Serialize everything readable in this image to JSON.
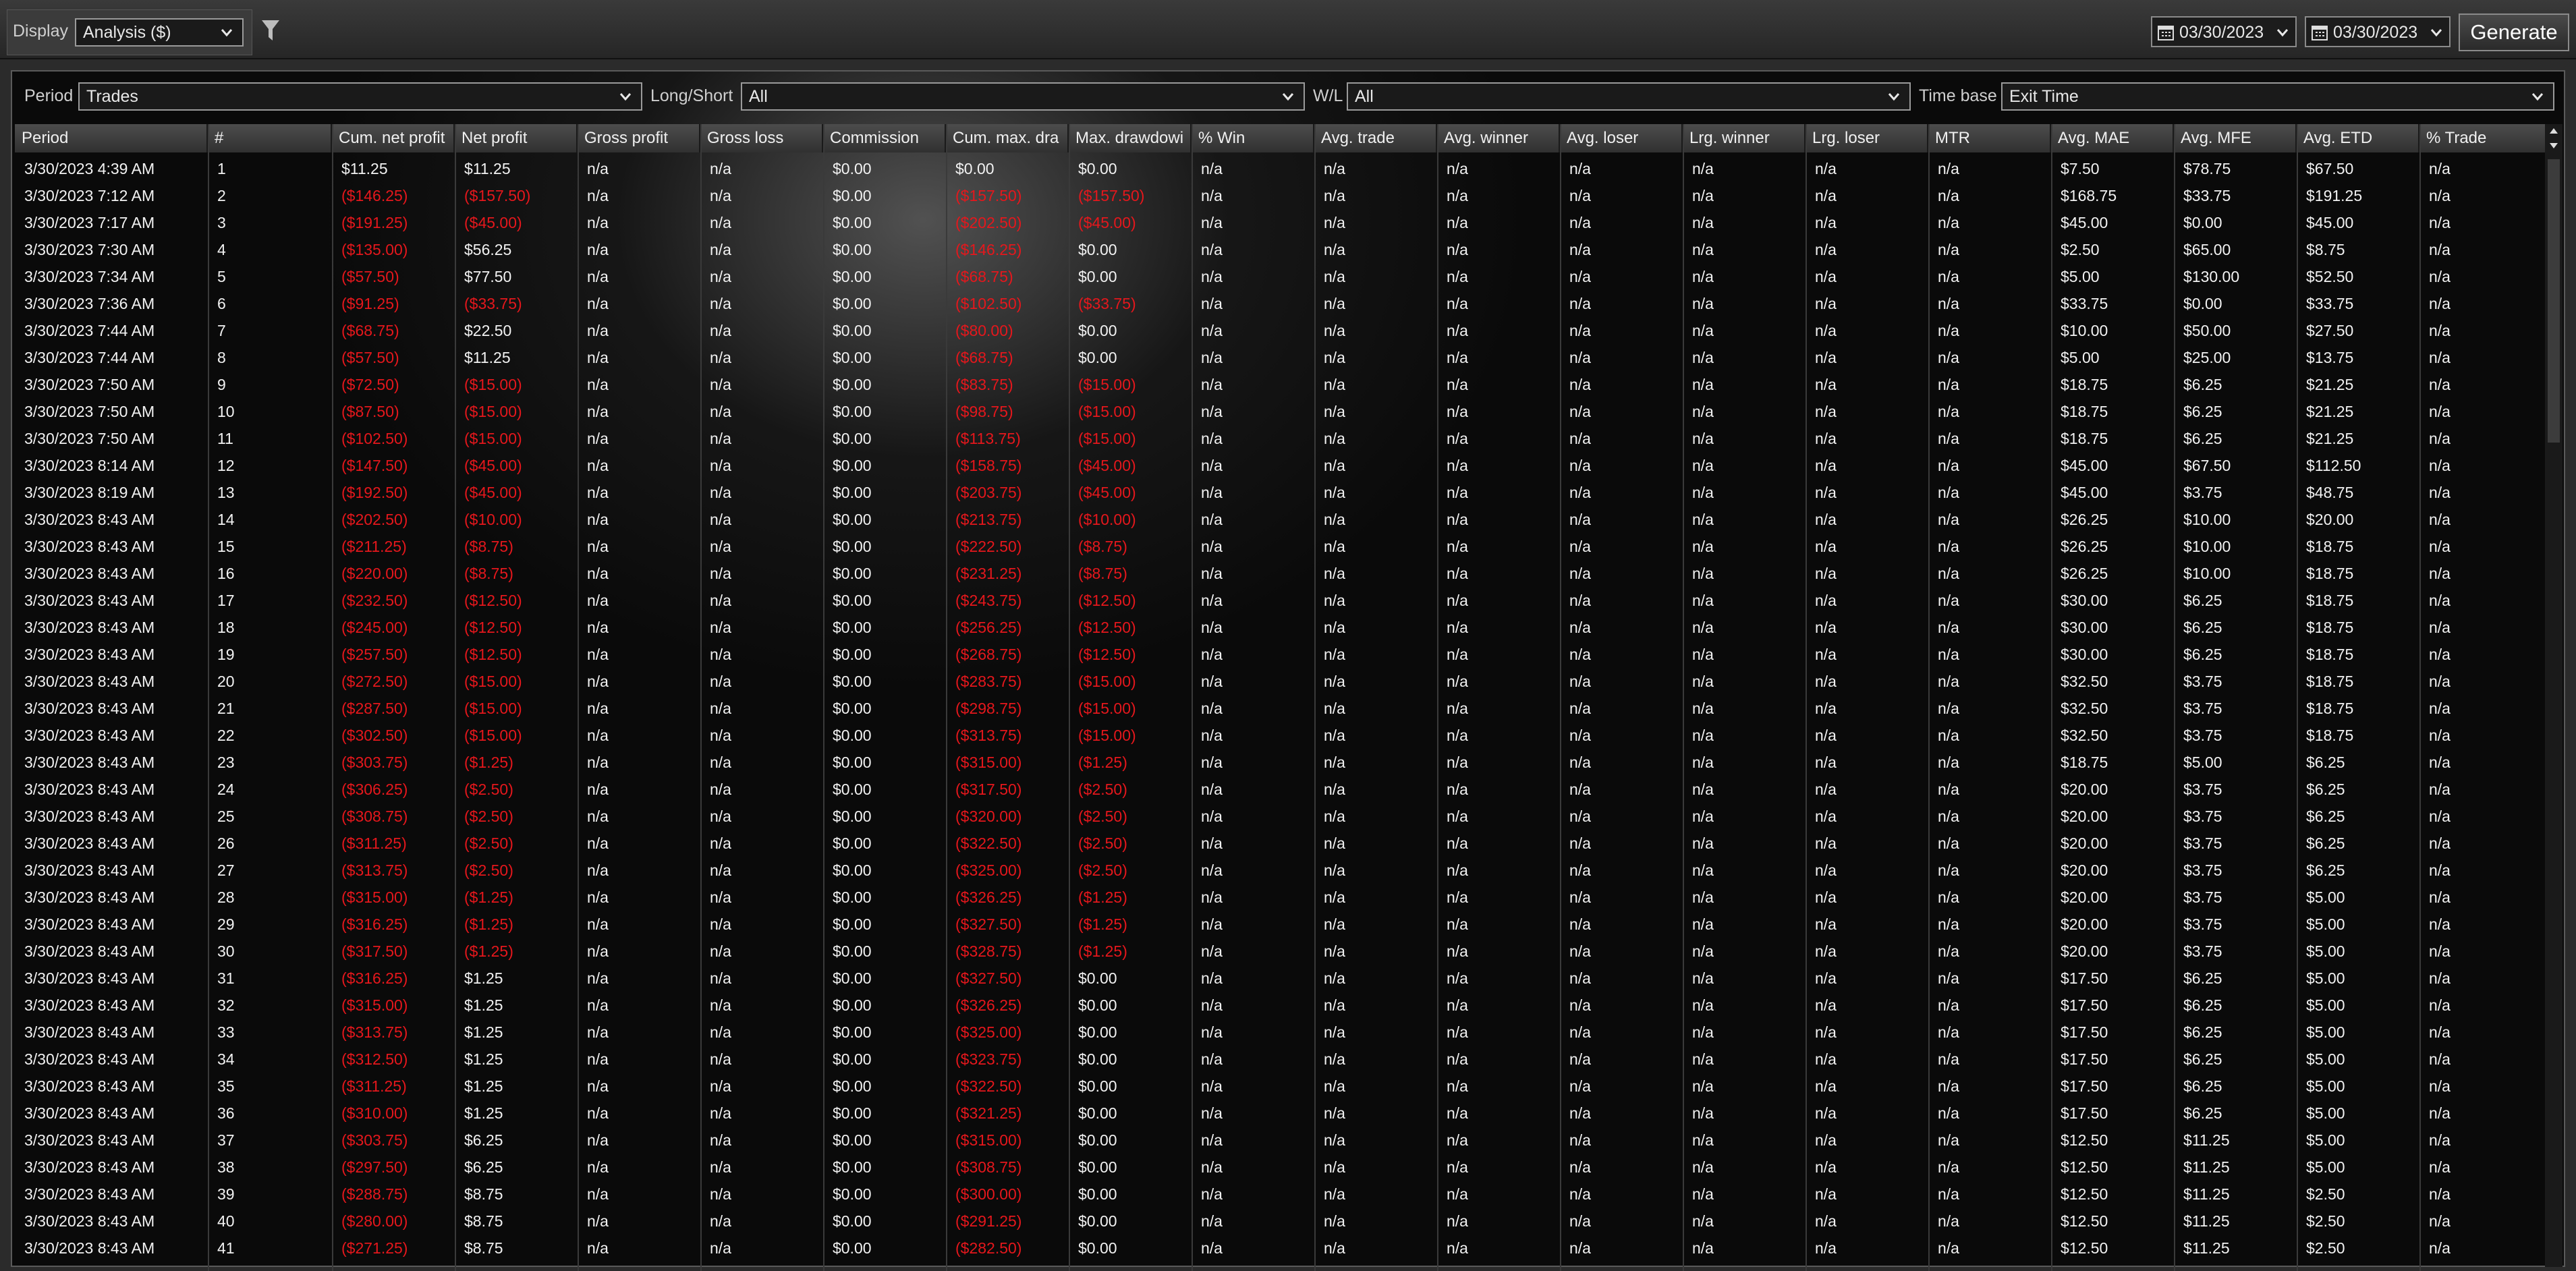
{
  "toolbar": {
    "display_label": "Display",
    "display_value": "Analysis ($)",
    "date_from": "03/30/2023",
    "date_to": "03/30/2023",
    "generate_label": "Generate"
  },
  "filters": {
    "period_label": "Period",
    "period_value": "Trades",
    "longshort_label": "Long/Short",
    "longshort_value": "All",
    "wl_label": "W/L",
    "wl_value": "All",
    "timebase_label": "Time base",
    "timebase_value": "Exit Time"
  },
  "columns": [
    "Period",
    "#",
    "Cum. net profit",
    "Net profit",
    "Gross profit",
    "Gross loss",
    "Commission",
    "Cum. max. dra",
    "Max. drawdowi",
    "% Win",
    "Avg. trade",
    "Avg. winner",
    "Avg. loser",
    "Lrg. winner",
    "Lrg. loser",
    "MTR",
    "Avg. MAE",
    "Avg. MFE",
    "Avg. ETD",
    "% Trade"
  ],
  "rows": [
    [
      "3/30/2023 4:39 AM",
      "1",
      "$11.25",
      "$11.25",
      "n/a",
      "n/a",
      "$0.00",
      "$0.00",
      "$0.00",
      "n/a",
      "n/a",
      "n/a",
      "n/a",
      "n/a",
      "n/a",
      "n/a",
      "$7.50",
      "$78.75",
      "$67.50",
      "n/a"
    ],
    [
      "3/30/2023 7:12 AM",
      "2",
      "($146.25)",
      "($157.50)",
      "n/a",
      "n/a",
      "$0.00",
      "($157.50)",
      "($157.50)",
      "n/a",
      "n/a",
      "n/a",
      "n/a",
      "n/a",
      "n/a",
      "n/a",
      "$168.75",
      "$33.75",
      "$191.25",
      "n/a"
    ],
    [
      "3/30/2023 7:17 AM",
      "3",
      "($191.25)",
      "($45.00)",
      "n/a",
      "n/a",
      "$0.00",
      "($202.50)",
      "($45.00)",
      "n/a",
      "n/a",
      "n/a",
      "n/a",
      "n/a",
      "n/a",
      "n/a",
      "$45.00",
      "$0.00",
      "$45.00",
      "n/a"
    ],
    [
      "3/30/2023 7:30 AM",
      "4",
      "($135.00)",
      "$56.25",
      "n/a",
      "n/a",
      "$0.00",
      "($146.25)",
      "$0.00",
      "n/a",
      "n/a",
      "n/a",
      "n/a",
      "n/a",
      "n/a",
      "n/a",
      "$2.50",
      "$65.00",
      "$8.75",
      "n/a"
    ],
    [
      "3/30/2023 7:34 AM",
      "5",
      "($57.50)",
      "$77.50",
      "n/a",
      "n/a",
      "$0.00",
      "($68.75)",
      "$0.00",
      "n/a",
      "n/a",
      "n/a",
      "n/a",
      "n/a",
      "n/a",
      "n/a",
      "$5.00",
      "$130.00",
      "$52.50",
      "n/a"
    ],
    [
      "3/30/2023 7:36 AM",
      "6",
      "($91.25)",
      "($33.75)",
      "n/a",
      "n/a",
      "$0.00",
      "($102.50)",
      "($33.75)",
      "n/a",
      "n/a",
      "n/a",
      "n/a",
      "n/a",
      "n/a",
      "n/a",
      "$33.75",
      "$0.00",
      "$33.75",
      "n/a"
    ],
    [
      "3/30/2023 7:44 AM",
      "7",
      "($68.75)",
      "$22.50",
      "n/a",
      "n/a",
      "$0.00",
      "($80.00)",
      "$0.00",
      "n/a",
      "n/a",
      "n/a",
      "n/a",
      "n/a",
      "n/a",
      "n/a",
      "$10.00",
      "$50.00",
      "$27.50",
      "n/a"
    ],
    [
      "3/30/2023 7:44 AM",
      "8",
      "($57.50)",
      "$11.25",
      "n/a",
      "n/a",
      "$0.00",
      "($68.75)",
      "$0.00",
      "n/a",
      "n/a",
      "n/a",
      "n/a",
      "n/a",
      "n/a",
      "n/a",
      "$5.00",
      "$25.00",
      "$13.75",
      "n/a"
    ],
    [
      "3/30/2023 7:50 AM",
      "9",
      "($72.50)",
      "($15.00)",
      "n/a",
      "n/a",
      "$0.00",
      "($83.75)",
      "($15.00)",
      "n/a",
      "n/a",
      "n/a",
      "n/a",
      "n/a",
      "n/a",
      "n/a",
      "$18.75",
      "$6.25",
      "$21.25",
      "n/a"
    ],
    [
      "3/30/2023 7:50 AM",
      "10",
      "($87.50)",
      "($15.00)",
      "n/a",
      "n/a",
      "$0.00",
      "($98.75)",
      "($15.00)",
      "n/a",
      "n/a",
      "n/a",
      "n/a",
      "n/a",
      "n/a",
      "n/a",
      "$18.75",
      "$6.25",
      "$21.25",
      "n/a"
    ],
    [
      "3/30/2023 7:50 AM",
      "11",
      "($102.50)",
      "($15.00)",
      "n/a",
      "n/a",
      "$0.00",
      "($113.75)",
      "($15.00)",
      "n/a",
      "n/a",
      "n/a",
      "n/a",
      "n/a",
      "n/a",
      "n/a",
      "$18.75",
      "$6.25",
      "$21.25",
      "n/a"
    ],
    [
      "3/30/2023 8:14 AM",
      "12",
      "($147.50)",
      "($45.00)",
      "n/a",
      "n/a",
      "$0.00",
      "($158.75)",
      "($45.00)",
      "n/a",
      "n/a",
      "n/a",
      "n/a",
      "n/a",
      "n/a",
      "n/a",
      "$45.00",
      "$67.50",
      "$112.50",
      "n/a"
    ],
    [
      "3/30/2023 8:19 AM",
      "13",
      "($192.50)",
      "($45.00)",
      "n/a",
      "n/a",
      "$0.00",
      "($203.75)",
      "($45.00)",
      "n/a",
      "n/a",
      "n/a",
      "n/a",
      "n/a",
      "n/a",
      "n/a",
      "$45.00",
      "$3.75",
      "$48.75",
      "n/a"
    ],
    [
      "3/30/2023 8:43 AM",
      "14",
      "($202.50)",
      "($10.00)",
      "n/a",
      "n/a",
      "$0.00",
      "($213.75)",
      "($10.00)",
      "n/a",
      "n/a",
      "n/a",
      "n/a",
      "n/a",
      "n/a",
      "n/a",
      "$26.25",
      "$10.00",
      "$20.00",
      "n/a"
    ],
    [
      "3/30/2023 8:43 AM",
      "15",
      "($211.25)",
      "($8.75)",
      "n/a",
      "n/a",
      "$0.00",
      "($222.50)",
      "($8.75)",
      "n/a",
      "n/a",
      "n/a",
      "n/a",
      "n/a",
      "n/a",
      "n/a",
      "$26.25",
      "$10.00",
      "$18.75",
      "n/a"
    ],
    [
      "3/30/2023 8:43 AM",
      "16",
      "($220.00)",
      "($8.75)",
      "n/a",
      "n/a",
      "$0.00",
      "($231.25)",
      "($8.75)",
      "n/a",
      "n/a",
      "n/a",
      "n/a",
      "n/a",
      "n/a",
      "n/a",
      "$26.25",
      "$10.00",
      "$18.75",
      "n/a"
    ],
    [
      "3/30/2023 8:43 AM",
      "17",
      "($232.50)",
      "($12.50)",
      "n/a",
      "n/a",
      "$0.00",
      "($243.75)",
      "($12.50)",
      "n/a",
      "n/a",
      "n/a",
      "n/a",
      "n/a",
      "n/a",
      "n/a",
      "$30.00",
      "$6.25",
      "$18.75",
      "n/a"
    ],
    [
      "3/30/2023 8:43 AM",
      "18",
      "($245.00)",
      "($12.50)",
      "n/a",
      "n/a",
      "$0.00",
      "($256.25)",
      "($12.50)",
      "n/a",
      "n/a",
      "n/a",
      "n/a",
      "n/a",
      "n/a",
      "n/a",
      "$30.00",
      "$6.25",
      "$18.75",
      "n/a"
    ],
    [
      "3/30/2023 8:43 AM",
      "19",
      "($257.50)",
      "($12.50)",
      "n/a",
      "n/a",
      "$0.00",
      "($268.75)",
      "($12.50)",
      "n/a",
      "n/a",
      "n/a",
      "n/a",
      "n/a",
      "n/a",
      "n/a",
      "$30.00",
      "$6.25",
      "$18.75",
      "n/a"
    ],
    [
      "3/30/2023 8:43 AM",
      "20",
      "($272.50)",
      "($15.00)",
      "n/a",
      "n/a",
      "$0.00",
      "($283.75)",
      "($15.00)",
      "n/a",
      "n/a",
      "n/a",
      "n/a",
      "n/a",
      "n/a",
      "n/a",
      "$32.50",
      "$3.75",
      "$18.75",
      "n/a"
    ],
    [
      "3/30/2023 8:43 AM",
      "21",
      "($287.50)",
      "($15.00)",
      "n/a",
      "n/a",
      "$0.00",
      "($298.75)",
      "($15.00)",
      "n/a",
      "n/a",
      "n/a",
      "n/a",
      "n/a",
      "n/a",
      "n/a",
      "$32.50",
      "$3.75",
      "$18.75",
      "n/a"
    ],
    [
      "3/30/2023 8:43 AM",
      "22",
      "($302.50)",
      "($15.00)",
      "n/a",
      "n/a",
      "$0.00",
      "($313.75)",
      "($15.00)",
      "n/a",
      "n/a",
      "n/a",
      "n/a",
      "n/a",
      "n/a",
      "n/a",
      "$32.50",
      "$3.75",
      "$18.75",
      "n/a"
    ],
    [
      "3/30/2023 8:43 AM",
      "23",
      "($303.75)",
      "($1.25)",
      "n/a",
      "n/a",
      "$0.00",
      "($315.00)",
      "($1.25)",
      "n/a",
      "n/a",
      "n/a",
      "n/a",
      "n/a",
      "n/a",
      "n/a",
      "$18.75",
      "$5.00",
      "$6.25",
      "n/a"
    ],
    [
      "3/30/2023 8:43 AM",
      "24",
      "($306.25)",
      "($2.50)",
      "n/a",
      "n/a",
      "$0.00",
      "($317.50)",
      "($2.50)",
      "n/a",
      "n/a",
      "n/a",
      "n/a",
      "n/a",
      "n/a",
      "n/a",
      "$20.00",
      "$3.75",
      "$6.25",
      "n/a"
    ],
    [
      "3/30/2023 8:43 AM",
      "25",
      "($308.75)",
      "($2.50)",
      "n/a",
      "n/a",
      "$0.00",
      "($320.00)",
      "($2.50)",
      "n/a",
      "n/a",
      "n/a",
      "n/a",
      "n/a",
      "n/a",
      "n/a",
      "$20.00",
      "$3.75",
      "$6.25",
      "n/a"
    ],
    [
      "3/30/2023 8:43 AM",
      "26",
      "($311.25)",
      "($2.50)",
      "n/a",
      "n/a",
      "$0.00",
      "($322.50)",
      "($2.50)",
      "n/a",
      "n/a",
      "n/a",
      "n/a",
      "n/a",
      "n/a",
      "n/a",
      "$20.00",
      "$3.75",
      "$6.25",
      "n/a"
    ],
    [
      "3/30/2023 8:43 AM",
      "27",
      "($313.75)",
      "($2.50)",
      "n/a",
      "n/a",
      "$0.00",
      "($325.00)",
      "($2.50)",
      "n/a",
      "n/a",
      "n/a",
      "n/a",
      "n/a",
      "n/a",
      "n/a",
      "$20.00",
      "$3.75",
      "$6.25",
      "n/a"
    ],
    [
      "3/30/2023 8:43 AM",
      "28",
      "($315.00)",
      "($1.25)",
      "n/a",
      "n/a",
      "$0.00",
      "($326.25)",
      "($1.25)",
      "n/a",
      "n/a",
      "n/a",
      "n/a",
      "n/a",
      "n/a",
      "n/a",
      "$20.00",
      "$3.75",
      "$5.00",
      "n/a"
    ],
    [
      "3/30/2023 8:43 AM",
      "29",
      "($316.25)",
      "($1.25)",
      "n/a",
      "n/a",
      "$0.00",
      "($327.50)",
      "($1.25)",
      "n/a",
      "n/a",
      "n/a",
      "n/a",
      "n/a",
      "n/a",
      "n/a",
      "$20.00",
      "$3.75",
      "$5.00",
      "n/a"
    ],
    [
      "3/30/2023 8:43 AM",
      "30",
      "($317.50)",
      "($1.25)",
      "n/a",
      "n/a",
      "$0.00",
      "($328.75)",
      "($1.25)",
      "n/a",
      "n/a",
      "n/a",
      "n/a",
      "n/a",
      "n/a",
      "n/a",
      "$20.00",
      "$3.75",
      "$5.00",
      "n/a"
    ],
    [
      "3/30/2023 8:43 AM",
      "31",
      "($316.25)",
      "$1.25",
      "n/a",
      "n/a",
      "$0.00",
      "($327.50)",
      "$0.00",
      "n/a",
      "n/a",
      "n/a",
      "n/a",
      "n/a",
      "n/a",
      "n/a",
      "$17.50",
      "$6.25",
      "$5.00",
      "n/a"
    ],
    [
      "3/30/2023 8:43 AM",
      "32",
      "($315.00)",
      "$1.25",
      "n/a",
      "n/a",
      "$0.00",
      "($326.25)",
      "$0.00",
      "n/a",
      "n/a",
      "n/a",
      "n/a",
      "n/a",
      "n/a",
      "n/a",
      "$17.50",
      "$6.25",
      "$5.00",
      "n/a"
    ],
    [
      "3/30/2023 8:43 AM",
      "33",
      "($313.75)",
      "$1.25",
      "n/a",
      "n/a",
      "$0.00",
      "($325.00)",
      "$0.00",
      "n/a",
      "n/a",
      "n/a",
      "n/a",
      "n/a",
      "n/a",
      "n/a",
      "$17.50",
      "$6.25",
      "$5.00",
      "n/a"
    ],
    [
      "3/30/2023 8:43 AM",
      "34",
      "($312.50)",
      "$1.25",
      "n/a",
      "n/a",
      "$0.00",
      "($323.75)",
      "$0.00",
      "n/a",
      "n/a",
      "n/a",
      "n/a",
      "n/a",
      "n/a",
      "n/a",
      "$17.50",
      "$6.25",
      "$5.00",
      "n/a"
    ],
    [
      "3/30/2023 8:43 AM",
      "35",
      "($311.25)",
      "$1.25",
      "n/a",
      "n/a",
      "$0.00",
      "($322.50)",
      "$0.00",
      "n/a",
      "n/a",
      "n/a",
      "n/a",
      "n/a",
      "n/a",
      "n/a",
      "$17.50",
      "$6.25",
      "$5.00",
      "n/a"
    ],
    [
      "3/30/2023 8:43 AM",
      "36",
      "($310.00)",
      "$1.25",
      "n/a",
      "n/a",
      "$0.00",
      "($321.25)",
      "$0.00",
      "n/a",
      "n/a",
      "n/a",
      "n/a",
      "n/a",
      "n/a",
      "n/a",
      "$17.50",
      "$6.25",
      "$5.00",
      "n/a"
    ],
    [
      "3/30/2023 8:43 AM",
      "37",
      "($303.75)",
      "$6.25",
      "n/a",
      "n/a",
      "$0.00",
      "($315.00)",
      "$0.00",
      "n/a",
      "n/a",
      "n/a",
      "n/a",
      "n/a",
      "n/a",
      "n/a",
      "$12.50",
      "$11.25",
      "$5.00",
      "n/a"
    ],
    [
      "3/30/2023 8:43 AM",
      "38",
      "($297.50)",
      "$6.25",
      "n/a",
      "n/a",
      "$0.00",
      "($308.75)",
      "$0.00",
      "n/a",
      "n/a",
      "n/a",
      "n/a",
      "n/a",
      "n/a",
      "n/a",
      "$12.50",
      "$11.25",
      "$5.00",
      "n/a"
    ],
    [
      "3/30/2023 8:43 AM",
      "39",
      "($288.75)",
      "$8.75",
      "n/a",
      "n/a",
      "$0.00",
      "($300.00)",
      "$0.00",
      "n/a",
      "n/a",
      "n/a",
      "n/a",
      "n/a",
      "n/a",
      "n/a",
      "$12.50",
      "$11.25",
      "$2.50",
      "n/a"
    ],
    [
      "3/30/2023 8:43 AM",
      "40",
      "($280.00)",
      "$8.75",
      "n/a",
      "n/a",
      "$0.00",
      "($291.25)",
      "$0.00",
      "n/a",
      "n/a",
      "n/a",
      "n/a",
      "n/a",
      "n/a",
      "n/a",
      "$12.50",
      "$11.25",
      "$2.50",
      "n/a"
    ],
    [
      "3/30/2023 8:43 AM",
      "41",
      "($271.25)",
      "$8.75",
      "n/a",
      "n/a",
      "$0.00",
      "($282.50)",
      "$0.00",
      "n/a",
      "n/a",
      "n/a",
      "n/a",
      "n/a",
      "n/a",
      "n/a",
      "$12.50",
      "$11.25",
      "$2.50",
      "n/a"
    ]
  ],
  "colors": {
    "negative": "#e5171c",
    "positive": "#f2f2f2",
    "background": "#0a0a0a"
  },
  "icons": {
    "filter": "filter-icon",
    "calendar": "calendar-icon",
    "dropdown": "chevron-down-icon"
  }
}
